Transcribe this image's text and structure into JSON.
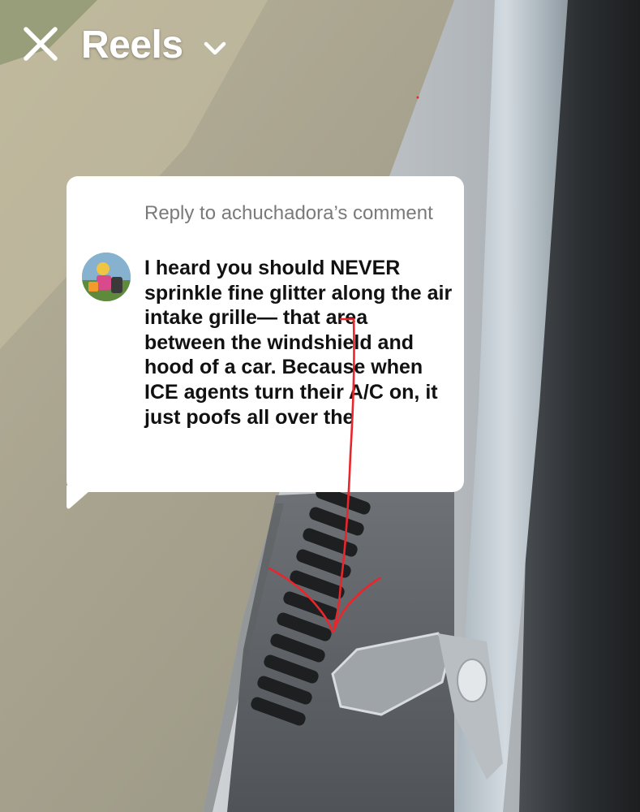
{
  "header": {
    "title": "Reels",
    "close_icon": "close-icon",
    "dropdown_icon": "chevron-down-icon"
  },
  "reply_card": {
    "header": "Reply to achuchadora’s comment",
    "comment": "I heard you should NEVER sprinkle fine glitter along the air intake grille— that area between the windshield and hood of a car. Because when ICE agents turn their A/C on, it just poofs all over the",
    "avatar_icon": "avatar"
  },
  "colors": {
    "annotation_stroke": "#e8262b",
    "bubble_background": "#ffffff",
    "header_text": "#7a7a7a",
    "comment_text": "#111111"
  }
}
